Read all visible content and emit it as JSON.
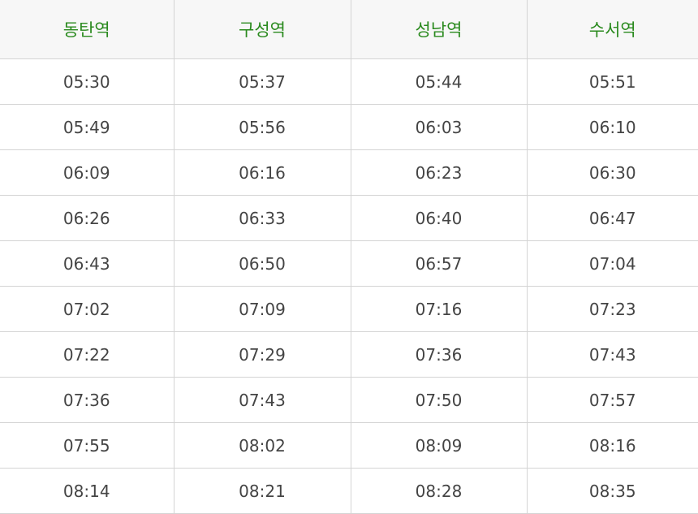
{
  "timetable": {
    "headers": [
      "동탄역",
      "구성역",
      "성남역",
      "수서역"
    ],
    "rows": [
      [
        "05:30",
        "05:37",
        "05:44",
        "05:51"
      ],
      [
        "05:49",
        "05:56",
        "06:03",
        "06:10"
      ],
      [
        "06:09",
        "06:16",
        "06:23",
        "06:30"
      ],
      [
        "06:26",
        "06:33",
        "06:40",
        "06:47"
      ],
      [
        "06:43",
        "06:50",
        "06:57",
        "07:04"
      ],
      [
        "07:02",
        "07:09",
        "07:16",
        "07:23"
      ],
      [
        "07:22",
        "07:29",
        "07:36",
        "07:43"
      ],
      [
        "07:36",
        "07:43",
        "07:50",
        "07:57"
      ],
      [
        "07:55",
        "08:02",
        "08:09",
        "08:16"
      ],
      [
        "08:14",
        "08:21",
        "08:28",
        "08:35"
      ]
    ]
  },
  "colors": {
    "header_text": "#2a8a1e",
    "header_bg": "#f7f7f7",
    "cell_text": "#444444",
    "border": "#d4d4d4"
  }
}
